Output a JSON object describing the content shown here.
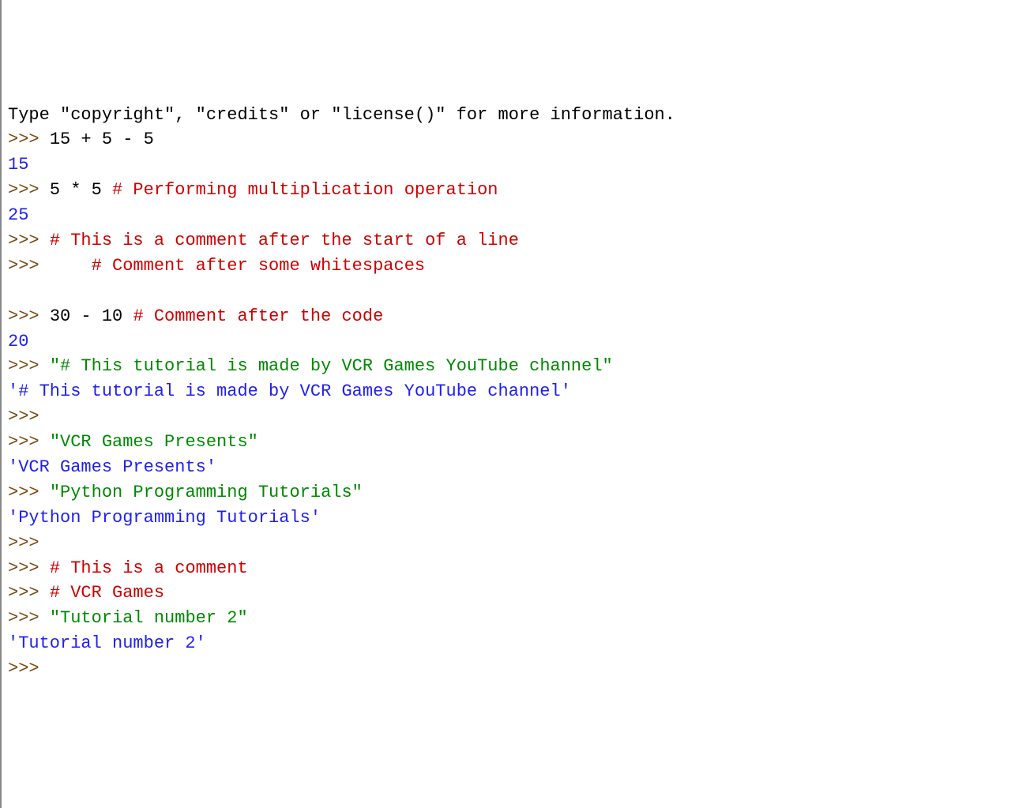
{
  "lines": [
    {
      "segments": [
        {
          "text": "Type \"copyright\", \"credits\" or \"license()\" for more information.",
          "cls": "code"
        }
      ]
    },
    {
      "segments": [
        {
          "text": ">>> ",
          "cls": "prompt"
        },
        {
          "text": "15 + 5 - 5",
          "cls": "code"
        }
      ]
    },
    {
      "segments": [
        {
          "text": "15",
          "cls": "output"
        }
      ]
    },
    {
      "segments": [
        {
          "text": ">>> ",
          "cls": "prompt"
        },
        {
          "text": "5 * 5 ",
          "cls": "code"
        },
        {
          "text": "# Performing multiplication operation",
          "cls": "comment"
        }
      ]
    },
    {
      "segments": [
        {
          "text": "25",
          "cls": "output"
        }
      ]
    },
    {
      "segments": [
        {
          "text": ">>> ",
          "cls": "prompt"
        },
        {
          "text": "# This is a comment after the start of a line",
          "cls": "comment"
        }
      ]
    },
    {
      "segments": [
        {
          "text": ">>>     ",
          "cls": "prompt"
        },
        {
          "text": "# Comment after some whitespaces",
          "cls": "comment"
        }
      ]
    },
    {
      "segments": [
        {
          "text": " ",
          "cls": "code"
        }
      ]
    },
    {
      "segments": [
        {
          "text": ">>> ",
          "cls": "prompt"
        },
        {
          "text": "30 - 10 ",
          "cls": "code"
        },
        {
          "text": "# Comment after the code",
          "cls": "comment"
        }
      ]
    },
    {
      "segments": [
        {
          "text": "20",
          "cls": "output"
        }
      ]
    },
    {
      "segments": [
        {
          "text": ">>> ",
          "cls": "prompt"
        },
        {
          "text": "\"# This tutorial is made by VCR Games YouTube channel\"",
          "cls": "string"
        }
      ]
    },
    {
      "segments": [
        {
          "text": "'# This tutorial is made by VCR Games YouTube channel'",
          "cls": "output"
        }
      ]
    },
    {
      "segments": [
        {
          "text": ">>> ",
          "cls": "prompt"
        }
      ]
    },
    {
      "segments": [
        {
          "text": ">>> ",
          "cls": "prompt"
        },
        {
          "text": "\"VCR Games Presents\"",
          "cls": "string"
        }
      ]
    },
    {
      "segments": [
        {
          "text": "'VCR Games Presents'",
          "cls": "output"
        }
      ]
    },
    {
      "segments": [
        {
          "text": ">>> ",
          "cls": "prompt"
        },
        {
          "text": "\"Python Programming Tutorials\"",
          "cls": "string"
        }
      ]
    },
    {
      "segments": [
        {
          "text": "'Python Programming Tutorials'",
          "cls": "output"
        }
      ]
    },
    {
      "segments": [
        {
          "text": ">>> ",
          "cls": "prompt"
        }
      ]
    },
    {
      "segments": [
        {
          "text": ">>> ",
          "cls": "prompt"
        },
        {
          "text": "# This is a comment",
          "cls": "comment"
        }
      ]
    },
    {
      "segments": [
        {
          "text": ">>> ",
          "cls": "prompt"
        },
        {
          "text": "# VCR Games",
          "cls": "comment"
        }
      ]
    },
    {
      "segments": [
        {
          "text": ">>> ",
          "cls": "prompt"
        },
        {
          "text": "\"Tutorial number 2\"",
          "cls": "string"
        }
      ]
    },
    {
      "segments": [
        {
          "text": "'Tutorial number 2'",
          "cls": "output"
        }
      ]
    },
    {
      "segments": [
        {
          "text": ">>> ",
          "cls": "prompt"
        }
      ]
    }
  ]
}
